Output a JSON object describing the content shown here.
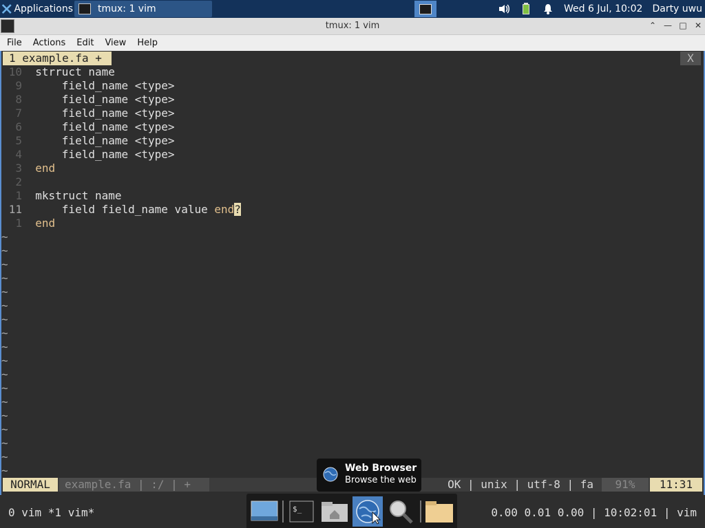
{
  "top_panel": {
    "applications_label": "Applications",
    "task_title": "tmux: 1 vim",
    "datetime": "Wed  6 Jul, 10:02",
    "user": "Darty uwu"
  },
  "window": {
    "title": "tmux: 1 vim"
  },
  "menu": [
    "File",
    "Actions",
    "Edit",
    "View",
    "Help"
  ],
  "vim": {
    "tab_label": "1 example.fa +",
    "tab_close": "X",
    "lines": [
      {
        "num": "10",
        "kw": "",
        "text": "strruct name",
        "tail": ""
      },
      {
        "num": "9",
        "kw": "",
        "text": "    field_name <type>",
        "tail": ""
      },
      {
        "num": "8",
        "kw": "",
        "text": "    field_name <type>",
        "tail": ""
      },
      {
        "num": "7",
        "kw": "",
        "text": "    field_name <type>",
        "tail": ""
      },
      {
        "num": "6",
        "kw": "",
        "text": "    field_name <type>",
        "tail": ""
      },
      {
        "num": "5",
        "kw": "",
        "text": "    field_name <type>",
        "tail": ""
      },
      {
        "num": "4",
        "kw": "",
        "text": "    field_name <type>",
        "tail": ""
      },
      {
        "num": "3",
        "kw": "end",
        "text": "",
        "tail": ""
      },
      {
        "num": "2",
        "kw": "",
        "text": "",
        "tail": ""
      },
      {
        "num": "1",
        "kw": "",
        "text": "mkstruct name",
        "tail": ""
      },
      {
        "num": "11",
        "kw": "",
        "text": "    field field_name value ",
        "tail": "end"
      },
      {
        "num": "1",
        "kw": "end",
        "text": "",
        "tail": ""
      }
    ],
    "cursor_char": "?",
    "tilde": "~",
    "mode": "NORMAL",
    "file_segment": "example.fa | :/ | +",
    "status_info": "OK | unix | utf-8 | fa",
    "percent": "91%",
    "position": "11:31"
  },
  "tmux": {
    "left": "0 vim *1 vim*",
    "right": "0.00 0.01 0.00 | 10:02:01 | vim"
  },
  "tooltip": {
    "title": "Web Browser",
    "subtitle": "Browse the web"
  },
  "colors": {
    "panel": "#13325a",
    "accent": "#4f86c7",
    "vim_highlight": "#e8dcb0",
    "keyword": "#e2c08d",
    "terminal_bg": "#2e2e2e"
  }
}
